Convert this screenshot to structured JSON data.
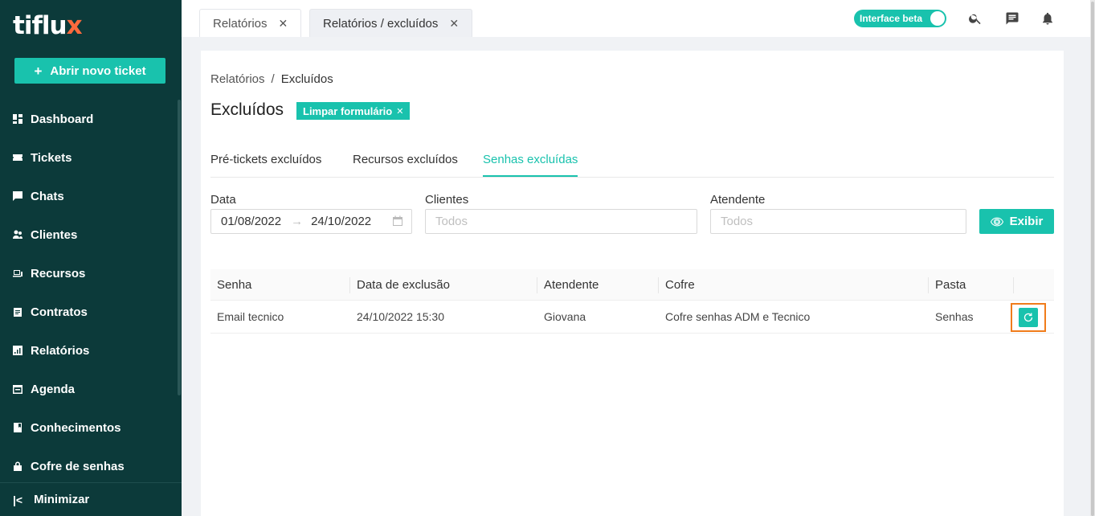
{
  "app": {
    "logo_main": "tiflu",
    "logo_x": "x",
    "new_ticket_label": "Abrir novo ticket"
  },
  "sidebar": {
    "items": [
      {
        "label": "Dashboard",
        "icon": "dashboard-icon"
      },
      {
        "label": "Tickets",
        "icon": "ticket-icon"
      },
      {
        "label": "Chats",
        "icon": "chat-icon"
      },
      {
        "label": "Clientes",
        "icon": "clients-icon"
      },
      {
        "label": "Recursos",
        "icon": "resources-icon"
      },
      {
        "label": "Contratos",
        "icon": "contract-icon"
      },
      {
        "label": "Relatórios",
        "icon": "reports-icon"
      },
      {
        "label": "Agenda",
        "icon": "calendar-icon"
      },
      {
        "label": "Conhecimentos",
        "icon": "book-icon"
      },
      {
        "label": "Cofre de senhas",
        "icon": "lock-icon"
      }
    ],
    "minimize_label": "Minimizar"
  },
  "topbar": {
    "tabs": [
      {
        "label": "Relatórios"
      },
      {
        "label": "Relatórios / excluídos"
      }
    ],
    "beta_label": "Interface beta"
  },
  "breadcrumb": {
    "parent": "Relatórios",
    "separator": "/",
    "current": "Excluídos"
  },
  "page": {
    "title": "Excluídos",
    "clear_label": "Limpar formulário"
  },
  "subtabs": [
    {
      "label": "Pré-tickets excluídos"
    },
    {
      "label": "Recursos excluídos"
    },
    {
      "label": "Senhas excluídas"
    }
  ],
  "filters": {
    "date_label": "Data",
    "date_start": "01/08/2022",
    "date_end": "24/10/2022",
    "clients_label": "Clientes",
    "clients_placeholder": "Todos",
    "attendant_label": "Atendente",
    "attendant_placeholder": "Todos",
    "submit_label": "Exibir"
  },
  "table": {
    "columns": [
      "Senha",
      "Data de exclusão",
      "Atendente",
      "Cofre",
      "Pasta"
    ],
    "rows": [
      [
        "Email tecnico",
        "24/10/2022 15:30",
        "Giovana",
        "Cofre senhas ADM e Tecnico",
        "Senhas"
      ]
    ]
  },
  "colors": {
    "sidebar_bg": "#0c3a3a",
    "accent": "#19c2ad",
    "highlight": "#f07c1b",
    "logo_accent": "#ff6a3d"
  }
}
